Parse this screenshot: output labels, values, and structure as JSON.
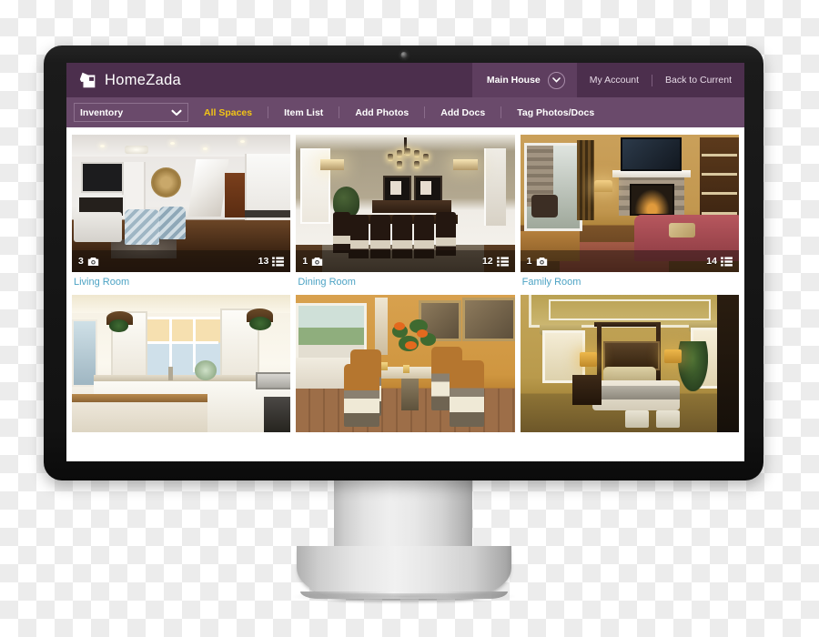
{
  "app": {
    "brand_name": "HomeZada",
    "brand_logo_icon": "house-logo-icon"
  },
  "header": {
    "house_tab": {
      "label": "Main House",
      "chevron_icon": "chevron-down-icon"
    },
    "links": [
      {
        "label": "My Account"
      },
      {
        "label": "Back to Current"
      }
    ]
  },
  "nav": {
    "dropdown": {
      "value": "Inventory",
      "chevron_icon": "chevron-down-icon"
    },
    "links": [
      {
        "label": "All Spaces",
        "active": true
      },
      {
        "label": "Item List",
        "active": false
      },
      {
        "label": "Add Photos",
        "active": false
      },
      {
        "label": "Add Docs",
        "active": false
      },
      {
        "label": "Tag Photos/Docs",
        "active": false
      }
    ]
  },
  "spaces": [
    {
      "title": "Living Room",
      "photo_count": "3",
      "item_count": "13",
      "photo_icon": "camera-icon",
      "item_icon": "list-icon"
    },
    {
      "title": "Dining Room",
      "photo_count": "1",
      "item_count": "12",
      "photo_icon": "camera-icon",
      "item_icon": "list-icon"
    },
    {
      "title": "Family Room",
      "photo_count": "1",
      "item_count": "14",
      "photo_icon": "camera-icon",
      "item_icon": "list-icon"
    },
    {
      "title": "",
      "photo_count": "",
      "item_count": "",
      "photo_icon": "camera-icon",
      "item_icon": "list-icon"
    },
    {
      "title": "",
      "photo_count": "",
      "item_count": "",
      "photo_icon": "camera-icon",
      "item_icon": "list-icon"
    },
    {
      "title": "",
      "photo_count": "",
      "item_count": "",
      "photo_icon": "camera-icon",
      "item_icon": "list-icon"
    }
  ],
  "colors": {
    "header_purple": "#4c2f4d",
    "nav_purple": "#6a4a6b",
    "tab_purple": "#5e3e5f",
    "accent_yellow": "#f2c416",
    "link_blue": "#4da3c4",
    "bezel_black": "#141414",
    "stand_silver": "#e3e3e3"
  }
}
